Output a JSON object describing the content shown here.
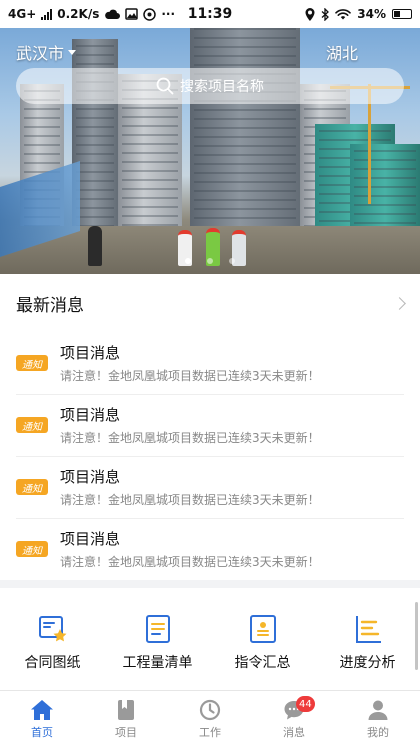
{
  "status_bar": {
    "network": "4G+",
    "speed": "0.2K/s",
    "time": "11:39",
    "battery": "34%"
  },
  "header": {
    "city": "武汉市",
    "province": "湖北",
    "search_placeholder": "搜索项目名称"
  },
  "banner": {
    "slides": 3,
    "active_slide": 1
  },
  "news": {
    "title": "最新消息",
    "items": [
      {
        "tag": "通知",
        "title": "项目消息",
        "desc": "请注意！金地凤凰城项目数据已连续3天未更新！"
      },
      {
        "tag": "通知",
        "title": "项目消息",
        "desc": "请注意！金地凤凰城项目数据已连续3天未更新！"
      },
      {
        "tag": "通知",
        "title": "项目消息",
        "desc": "请注意！金地凤凰城项目数据已连续3天未更新！"
      },
      {
        "tag": "通知",
        "title": "项目消息",
        "desc": "请注意！金地凤凰城项目数据已连续3天未更新！"
      }
    ]
  },
  "shortcuts": [
    {
      "label": "合同图纸",
      "icon": "contract-drawing-icon"
    },
    {
      "label": "工程量清单",
      "icon": "quantity-list-icon"
    },
    {
      "label": "指令汇总",
      "icon": "instruction-summary-icon"
    },
    {
      "label": "进度分析",
      "icon": "progress-analysis-icon"
    }
  ],
  "tabbar": {
    "tabs": [
      {
        "label": "首页",
        "icon": "home-icon"
      },
      {
        "label": "项目",
        "icon": "book-icon"
      },
      {
        "label": "工作",
        "icon": "clock-icon"
      },
      {
        "label": "消息",
        "icon": "message-icon",
        "badge": "44"
      },
      {
        "label": "我的",
        "icon": "user-icon"
      }
    ]
  },
  "colors": {
    "accent": "#2f6fd8",
    "tag": "#f5a623",
    "badge": "#ee3b3b"
  }
}
